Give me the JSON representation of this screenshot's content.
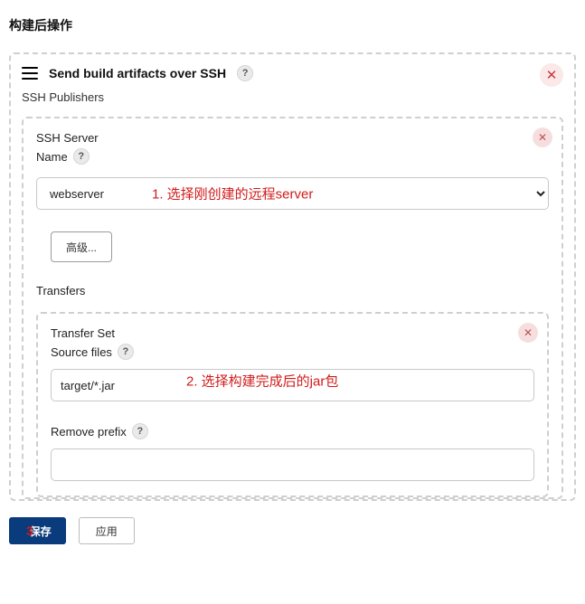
{
  "section": {
    "title": "构建后操作"
  },
  "step": {
    "title": "Send build artifacts over SSH",
    "publishers_label": "SSH Publishers",
    "ssh_server_label": "SSH Server",
    "name_label": "Name",
    "server_value": "webserver",
    "server_options": [
      "webserver"
    ],
    "advanced_label": "高级...",
    "transfers_label": "Transfers",
    "transfer_set_label": "Transfer Set",
    "source_files_label": "Source files",
    "source_files_value": "target/*.jar",
    "remove_prefix_label": "Remove prefix",
    "remove_prefix_value": ""
  },
  "annotations": {
    "a1": "1. 选择刚创建的远程server",
    "a2": "2. 选择构建完成后的jar包",
    "a3": "3"
  },
  "footer": {
    "save": "保存",
    "apply": "应用"
  },
  "icons": {
    "help": "?",
    "close": "✕"
  }
}
